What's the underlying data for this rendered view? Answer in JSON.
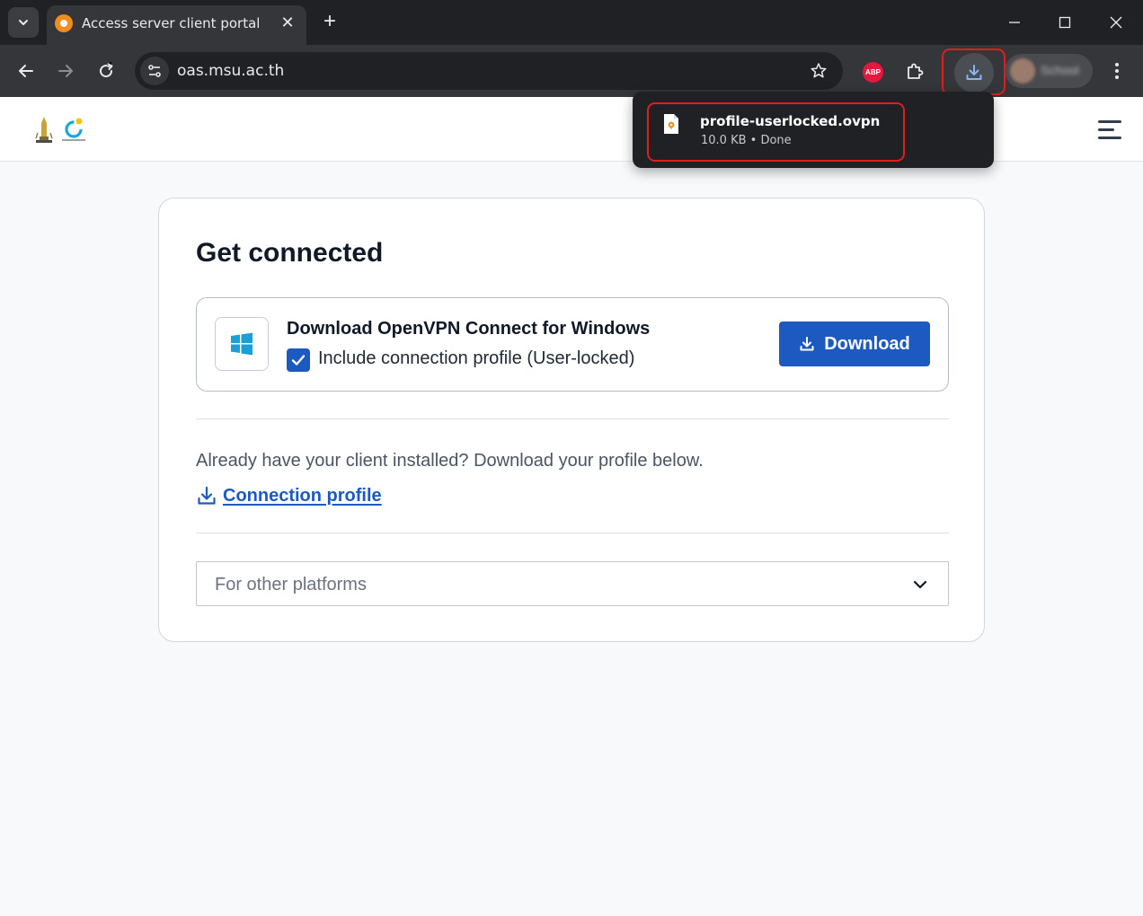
{
  "browser": {
    "tab_title": "Access server client portal",
    "tab_close": "✕",
    "new_tab": "+",
    "url": "oas.msu.ac.th",
    "abp_label": "ABP",
    "profile_name": "School",
    "icons": [
      "tab-search-icon",
      "favicon-openvpn-icon",
      "minimize-icon",
      "maximize-icon",
      "close-window-icon",
      "back-icon",
      "forward-icon",
      "reload-icon",
      "site-info-icon",
      "bookmark-star-icon",
      "adblock-plus-icon",
      "extensions-icon",
      "downloads-icon",
      "more-menu-icon"
    ]
  },
  "download_bubble": {
    "file_name": "profile-userlocked.ovpn",
    "file_meta": "10.0 KB • Done",
    "icon": "file-icon"
  },
  "page": {
    "logo": "university-logo",
    "card": {
      "title": "Get connected",
      "download_box": {
        "title": "Download OpenVPN Connect for Windows",
        "checkbox_label": "Include connection profile (User-locked)",
        "checkbox_checked": true,
        "button_label": "Download"
      },
      "already_text": "Already have your client installed? Download your profile below.",
      "profile_link": "Connection profile",
      "platforms_label": "For other platforms"
    }
  },
  "colors": {
    "primary": "#1c5ac2",
    "highlight": "#e11d1d",
    "chrome_dark": "#202124",
    "chrome_toolbar": "#35363a"
  }
}
